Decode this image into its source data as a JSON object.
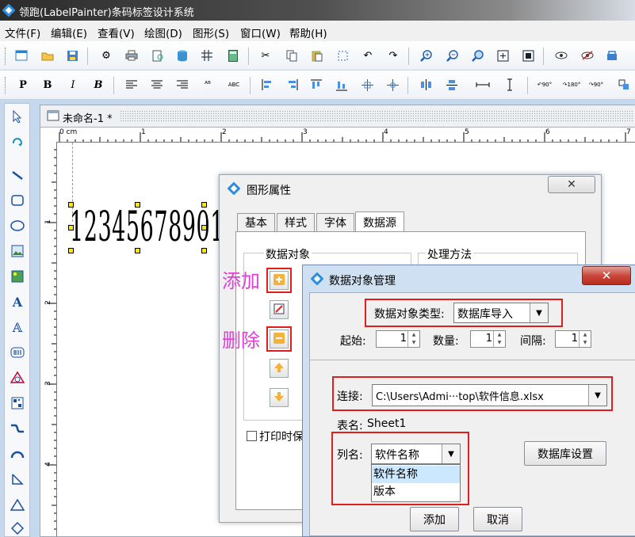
{
  "app": {
    "title": "领跑(LabelPainter)条码标签设计系统"
  },
  "menu": [
    "文件(F)",
    "编辑(E)",
    "查看(V)",
    "绘图(D)",
    "图形(S)",
    "窗口(W)",
    "帮助(H)"
  ],
  "format_toolbar": {
    "bold_p": "P",
    "bold": "B",
    "italic": "I",
    "bold_italic": "B",
    "abc": "ABC"
  },
  "document": {
    "tab_title": "未命名-1 *",
    "ruler_unit": "0 cm",
    "ruler_h": [
      "1",
      "2",
      "3",
      "4",
      "5",
      "6",
      "7"
    ],
    "ruler_v": [
      "1",
      "2",
      "3",
      "4"
    ],
    "barcode_text": "123456789012"
  },
  "annotations": {
    "add": "添加",
    "delete": "删除"
  },
  "props_dialog": {
    "title": "图形属性",
    "tabs": [
      "基本",
      "样式",
      "字体",
      "数据源"
    ],
    "active_tab": "数据源",
    "data_object_label": "数据对象",
    "process_label": "处理方法",
    "print_check_label": "打印时保"
  },
  "data_dialog": {
    "title": "数据对象管理",
    "type_label": "数据对象类型:",
    "type_value": "数据库导入",
    "start_label": "起始:",
    "start_value": "1",
    "count_label": "数量:",
    "count_value": "1",
    "interval_label": "间隔:",
    "interval_value": "1",
    "connect_label": "连接:",
    "connect_value": "C:\\Users\\Admi···top\\软件信息.xlsx",
    "table_label": "表名:",
    "table_value": "Sheet1",
    "column_label": "列名:",
    "column_value": "软件名称",
    "column_options": [
      "软件名称",
      "版本"
    ],
    "db_settings_button": "数据库设置",
    "add_button": "添加",
    "cancel_button": "取消"
  },
  "colors": {
    "annotation": "#e03fd8",
    "highlight_box": "#e21d1d",
    "dropdown_selected": "#cce8ff"
  }
}
